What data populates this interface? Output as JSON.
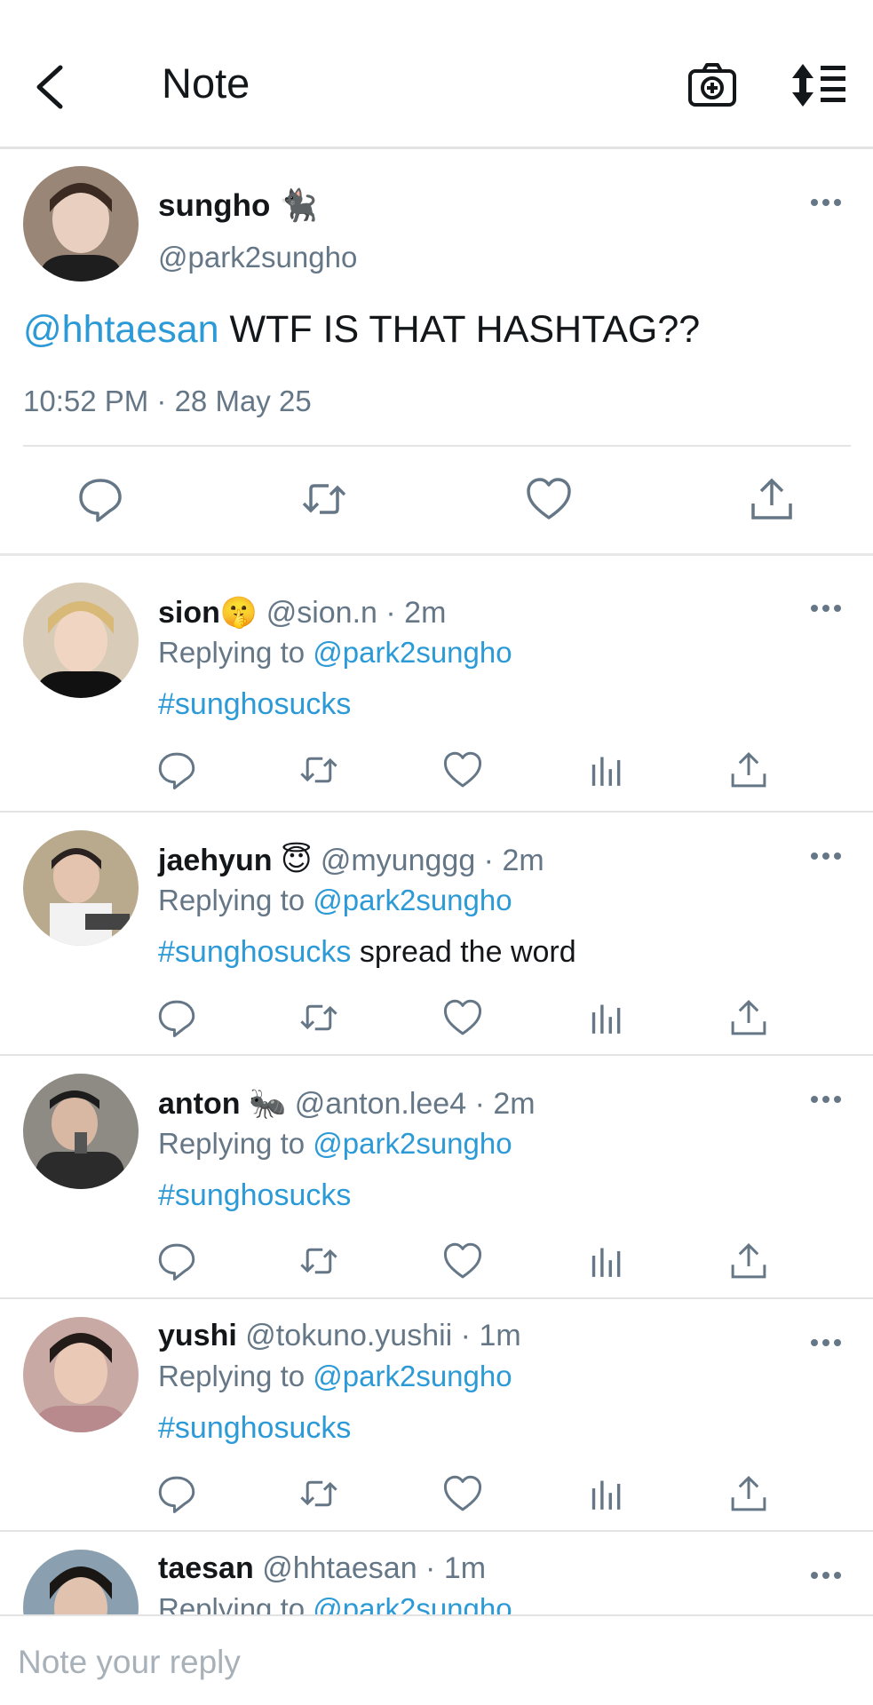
{
  "header": {
    "title": "Note",
    "icons": [
      "back-icon",
      "camera-plus-icon",
      "sort-icon"
    ]
  },
  "main_note": {
    "name": "sungho",
    "name_emoji": "🐈‍⬛",
    "handle": "@park2sungho",
    "mention": "@hhtaesan",
    "text": " WTF IS THAT HASHTAG??",
    "time": "10:52 PM · 28 May 25"
  },
  "replies": [
    {
      "name": "sion",
      "emoji": "🤫",
      "meta": "@sion.n · 2m",
      "replying_prefix": "Replying to ",
      "replying_to": "@park2sungho",
      "hashtag": "#sunghosucks",
      "text": ""
    },
    {
      "name": "jaehyun",
      "emoji": "😇",
      "meta": "@myunggg · 2m",
      "replying_prefix": "Replying to ",
      "replying_to": "@park2sungho",
      "hashtag": "#sunghosucks",
      "text": " spread the word"
    },
    {
      "name": "anton",
      "emoji": "🐜",
      "meta": "@anton.lee4 · 2m",
      "replying_prefix": "Replying to ",
      "replying_to": "@park2sungho",
      "hashtag": "#sunghosucks",
      "text": ""
    },
    {
      "name": "yushi",
      "emoji": "",
      "meta": "@tokuno.yushii · 1m",
      "replying_prefix": "Replying to ",
      "replying_to": "@park2sungho",
      "hashtag": "#sunghosucks",
      "text": ""
    },
    {
      "name": "taesan",
      "emoji": "",
      "meta": "@hhtaesan · 1m",
      "replying_prefix": "Replying to ",
      "replying_to": "@park2sungho",
      "hashtag": "",
      "text": ""
    }
  ],
  "composer": {
    "placeholder": "Note your reply"
  },
  "colors": {
    "accent": "#2c9ad6",
    "muted": "#657786",
    "divider": "#e3e3e3"
  }
}
